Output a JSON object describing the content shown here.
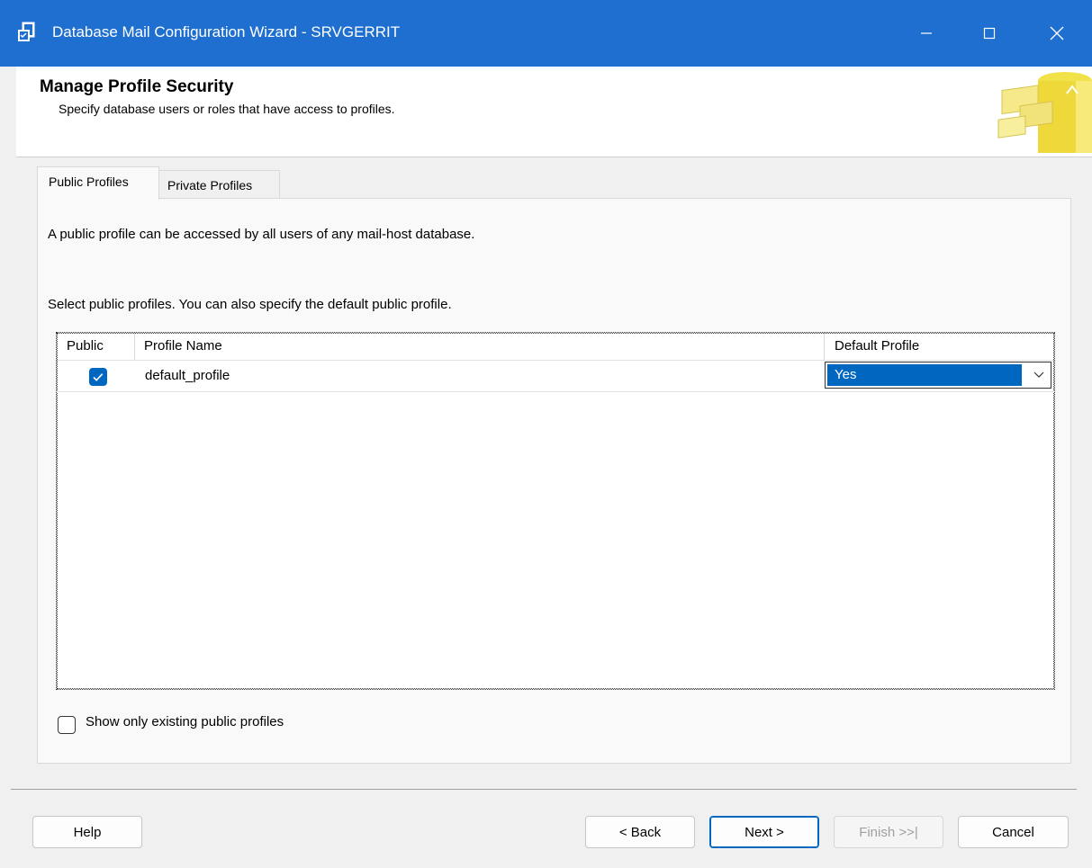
{
  "window": {
    "title": "Database Mail Configuration Wizard - SRVGERRIT"
  },
  "header": {
    "title": "Manage Profile Security",
    "subtitle": "Specify database users or roles that have access to profiles."
  },
  "tabs": [
    {
      "label": "Public Profiles",
      "active": true
    },
    {
      "label": "Private Profiles",
      "active": false
    }
  ],
  "panel": {
    "description": "A public profile can be accessed by all users of any mail-host database.",
    "instruction": "Select public profiles. You can also specify the default public profile."
  },
  "grid": {
    "columns": [
      "Public",
      "Profile Name",
      "Default Profile"
    ],
    "rows": [
      {
        "public": true,
        "profile_name": "default_profile",
        "default_profile": "Yes"
      }
    ]
  },
  "show_only_existing": {
    "label": "Show only existing public profiles",
    "checked": false
  },
  "buttons": {
    "help": "Help",
    "back": "< Back",
    "next": "Next >",
    "finish": "Finish >>|",
    "cancel": "Cancel"
  },
  "colors": {
    "titlebar": "#1f6fd0",
    "accent": "#0067c0"
  }
}
